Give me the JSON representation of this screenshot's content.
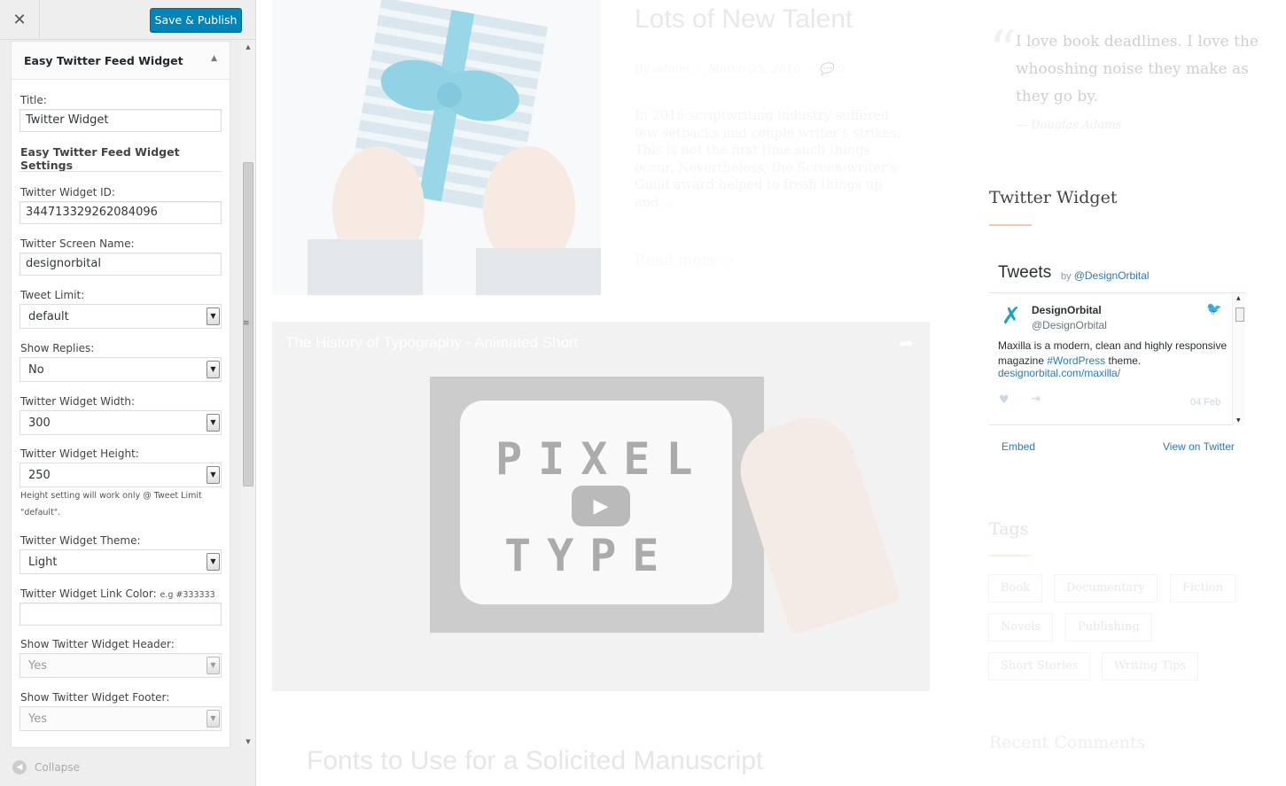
{
  "customizer": {
    "close_icon": "close-icon",
    "publish_label": "Save & Publish",
    "widget_title": "Easy Twitter Feed Widget",
    "fields": {
      "title_label": "Title:",
      "title_value": "Twitter Widget",
      "settings_heading": "Easy Twitter Feed Widget Settings",
      "widget_id_label": "Twitter Widget ID:",
      "widget_id_value": "344713329262084096",
      "screen_name_label": "Twitter Screen Name:",
      "screen_name_value": "designorbital",
      "tweet_limit_label": "Tweet Limit:",
      "tweet_limit_value": "default",
      "show_replies_label": "Show Replies:",
      "show_replies_value": "No",
      "width_label": "Twitter Widget Width:",
      "width_value": "300",
      "height_label": "Twitter Widget Height:",
      "height_value": "250",
      "height_note": "Height setting will work only @ Tweet Limit \"default\".",
      "theme_label": "Twitter Widget Theme:",
      "theme_value": "Light",
      "link_color_label": "Twitter Widget Link Color:",
      "link_color_hint": "e.g #333333",
      "link_color_value": "",
      "show_header_label": "Show Twitter Widget Header:",
      "show_header_value": "Yes",
      "show_footer_label": "Show Twitter Widget Footer:",
      "show_footer_value": "Yes"
    },
    "collapse_label": "Collapse"
  },
  "preview": {
    "post": {
      "title": "Lots of New Talent",
      "meta_by": "By",
      "meta_author": "admin",
      "meta_date": "March 25, 2016",
      "meta_comments": "0",
      "excerpt": "In 2015 scriptwriting industry suffered few setbacks and couple writer's strikes. This is not the first time such things occur. Nevertheless, the Screen-writer's Guild award helped to fresh things up and ...",
      "read_more": "Read more"
    },
    "video": {
      "title": "The History of Typography - Animated Short",
      "word1": "PIXEL",
      "word2": "TYPE"
    },
    "next_post_title": "Fonts to Use for a Solicited Manuscript",
    "quote": {
      "text": "I love book deadlines. I love the whooshing noise they make as they go by.",
      "author": "— Douglas Adams"
    },
    "twitter_widget": {
      "heading": "Twitter Widget",
      "tweets_label": "Tweets",
      "by_label": "by",
      "by_handle": "@DesignOrbital",
      "tweet": {
        "name": "DesignOrbital",
        "handle": "@DesignOrbital",
        "text_before": "Maxilla is a modern, clean and highly responsive magazine ",
        "hashtag": "#WordPress",
        "text_after": " theme.",
        "link": "designorbital.com/maxilla/",
        "date": "04 Feb"
      },
      "embed_label": "Embed",
      "view_label": "View on Twitter"
    },
    "tags": {
      "heading": "Tags",
      "items": [
        "Book",
        "Documentary",
        "Fiction",
        "Novels",
        "Publishing",
        "Short Stories",
        "Writing Tips"
      ]
    },
    "recent_comments_heading": "Recent Comments"
  },
  "colors": {
    "publish_button": "#0085ba",
    "twitter_link": "#2b7bb9",
    "accent_line": "#f3c9b0"
  }
}
